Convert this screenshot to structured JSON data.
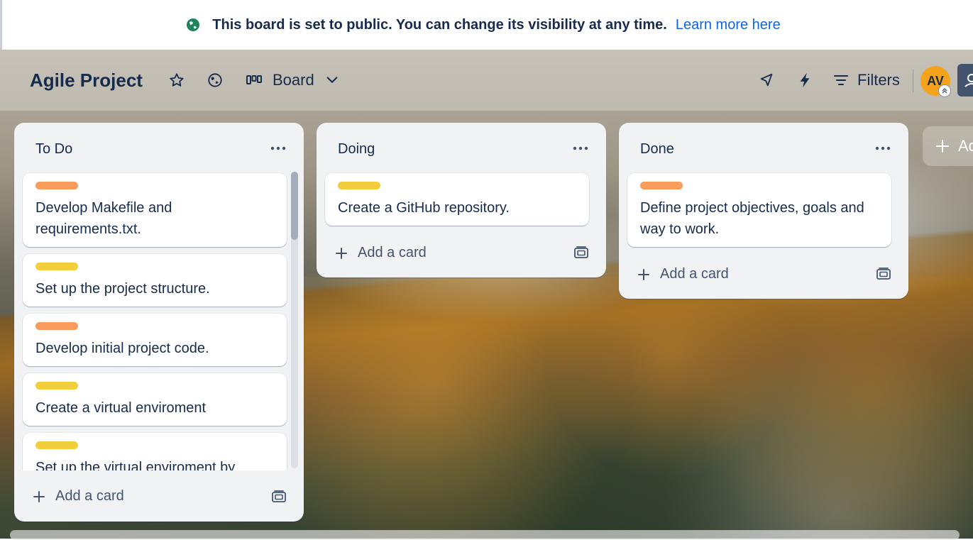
{
  "banner": {
    "message": "This board is set to public. You can change its visibility at any time.",
    "link": "Learn more here"
  },
  "header": {
    "title": "Agile Project",
    "view_label": "Board",
    "filters_label": "Filters",
    "avatar_initials": "AV"
  },
  "lists": [
    {
      "title": "To Do",
      "cards": [
        {
          "label_color": "orange",
          "text": "Develop Makefile and requirements.txt."
        },
        {
          "label_color": "yellow",
          "text": "Set up the project structure."
        },
        {
          "label_color": "orange",
          "text": "Develop initial project code."
        },
        {
          "label_color": "yellow",
          "text": "Create a virtual enviroment"
        },
        {
          "label_color": "yellow",
          "text": "Set up the virtual enviroment by"
        }
      ],
      "add_card_label": "Add a card"
    },
    {
      "title": "Doing",
      "cards": [
        {
          "label_color": "yellow",
          "text": "Create a GitHub repository."
        }
      ],
      "add_card_label": "Add a card"
    },
    {
      "title": "Done",
      "cards": [
        {
          "label_color": "orange",
          "text": "Define project objectives, goals and way to work."
        }
      ],
      "add_card_label": "Add a card"
    }
  ],
  "add_list_label": "Ad",
  "colors": {
    "label_orange": "#f99c5c",
    "label_yellow": "#f2cd3c",
    "link": "#0c66e4",
    "avatar": "#f5a21c"
  }
}
